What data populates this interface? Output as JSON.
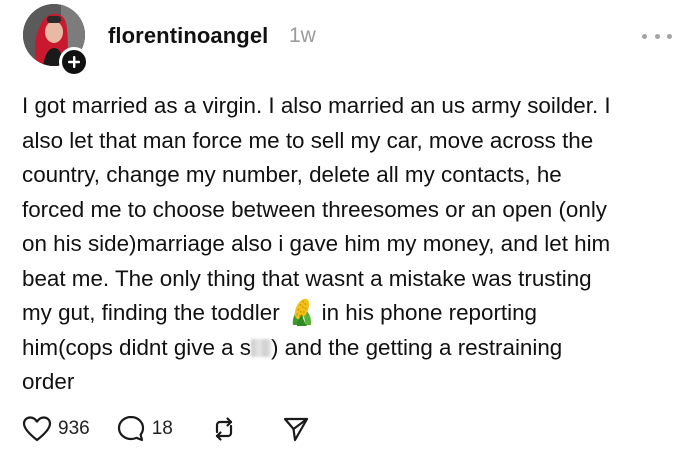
{
  "post": {
    "username": "florentinoangel",
    "timestamp": "1w",
    "lines": [
      "I got married as a virgin. I also married an us army soilder. I",
      "also let that man force me to sell my car, move across the",
      "country, change my number, delete all my contacts, he",
      "forced me to choose between threesomes or an open (only",
      "on his side)marriage also i gave him my money, and let him",
      "beat me. The only thing that wasnt a mistake was trusting"
    ],
    "line7_before": "my gut, finding the toddler",
    "line7_after": "in his phone reporting",
    "line8_before": "him(cops didnt give a s",
    "line8_after": ") and the  getting a restraining",
    "line9": "order",
    "inline_emoji": "corn-icon"
  },
  "actions": {
    "like_count": "936",
    "comment_count": "18"
  },
  "icons": {
    "like": "heart-icon",
    "comment": "comment-bubble-icon",
    "repost": "repost-icon",
    "share": "send-icon",
    "more": "more-dots-icon",
    "follow": "plus-icon"
  },
  "colors": {
    "text": "#111111",
    "muted": "#9b9b9b",
    "avatar_accent": "#d8243a"
  }
}
